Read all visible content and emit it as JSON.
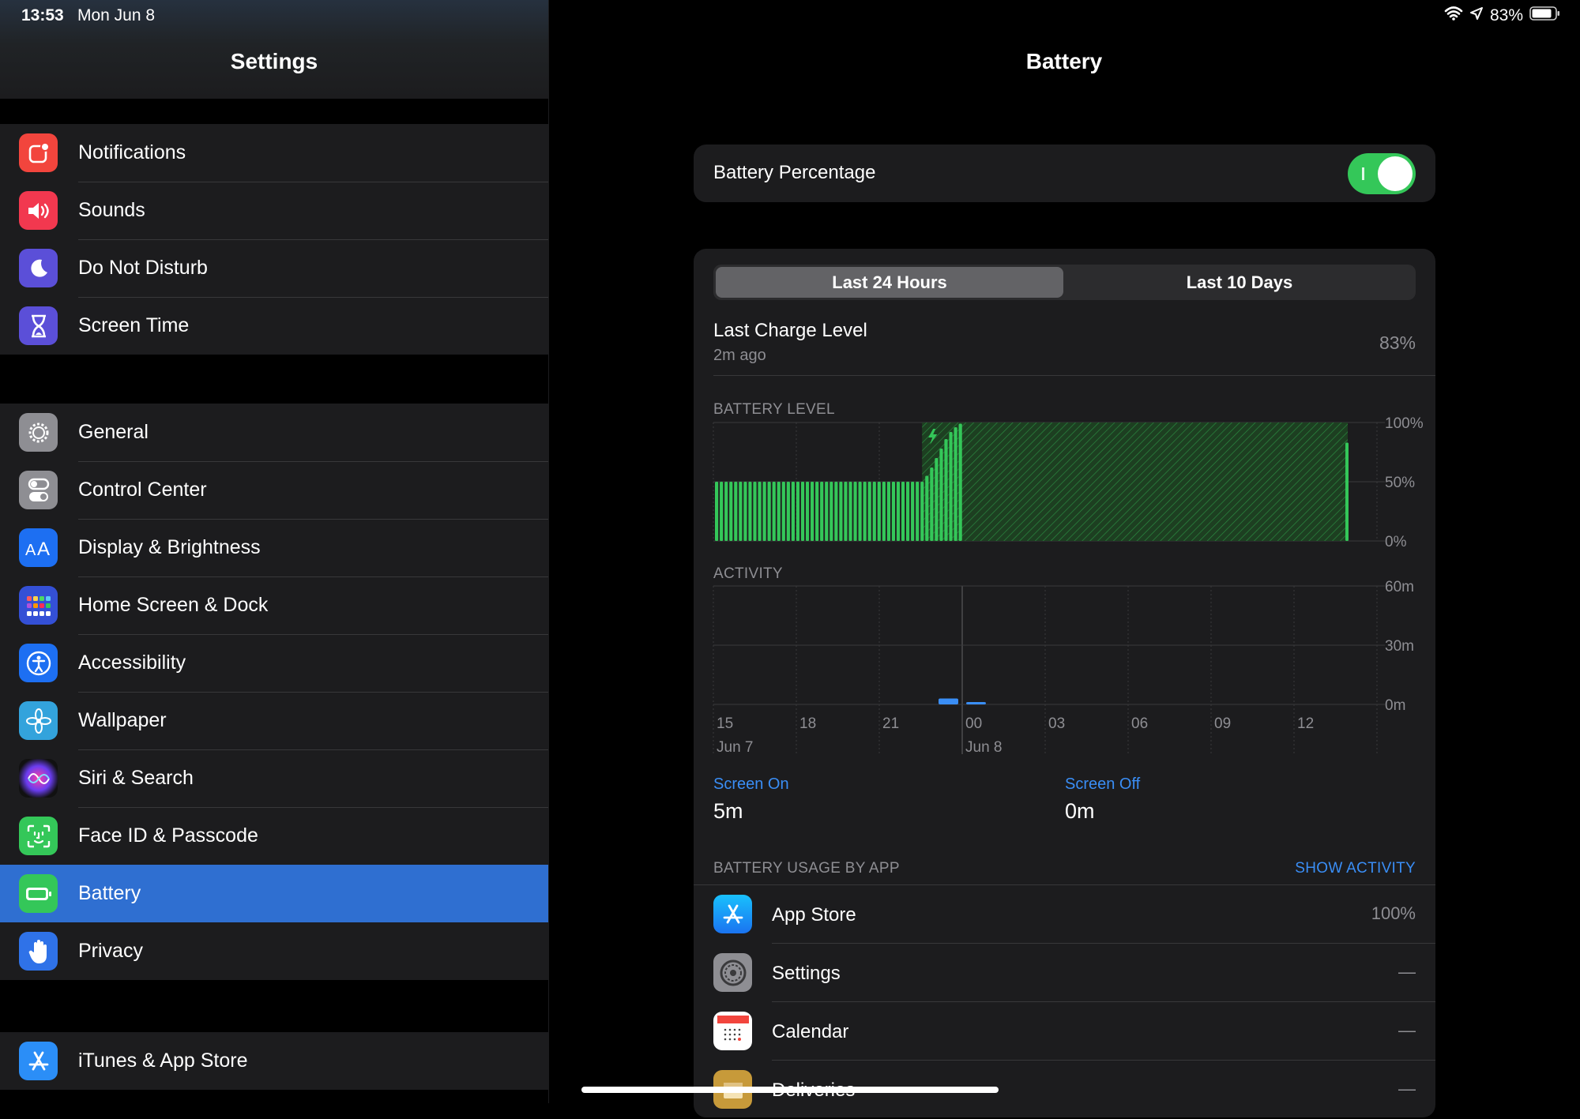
{
  "status": {
    "time": "13:53",
    "date": "Mon Jun 8",
    "battery": "83%"
  },
  "sidebar": {
    "title": "Settings",
    "groups": [
      [
        {
          "label": "Notifications",
          "icon": "notifications-icon",
          "color": "#f2453d"
        },
        {
          "label": "Sounds",
          "icon": "speaker-icon",
          "color": "#f2384f"
        },
        {
          "label": "Do Not Disturb",
          "icon": "moon-icon",
          "color": "#5b4fd8"
        },
        {
          "label": "Screen Time",
          "icon": "hourglass-icon",
          "color": "#5b4fd8"
        }
      ],
      [
        {
          "label": "General",
          "icon": "gear-icon",
          "color": "#8e8e93"
        },
        {
          "label": "Control Center",
          "icon": "toggles-icon",
          "color": "#8e8e93"
        },
        {
          "label": "Display & Brightness",
          "icon": "text-size-icon",
          "color": "#1d6ff2"
        },
        {
          "label": "Home Screen & Dock",
          "icon": "app-grid-icon",
          "color": "#3450d6"
        },
        {
          "label": "Accessibility",
          "icon": "accessibility-icon",
          "color": "#1d6ff2"
        },
        {
          "label": "Wallpaper",
          "icon": "flower-icon",
          "color": "#33a3dc"
        },
        {
          "label": "Siri & Search",
          "icon": "siri-icon",
          "color": "#222"
        },
        {
          "label": "Face ID & Passcode",
          "icon": "face-id-icon",
          "color": "#34c759"
        },
        {
          "label": "Battery",
          "icon": "battery-icon",
          "color": "#34c759",
          "selected": true
        },
        {
          "label": "Privacy",
          "icon": "hand-icon",
          "color": "#2f72e8"
        }
      ],
      [
        {
          "label": "iTunes & App Store",
          "icon": "app-store-icon",
          "color": "#2b8ef7"
        }
      ]
    ]
  },
  "detail": {
    "title": "Battery",
    "battery_percentage": {
      "label": "Battery Percentage",
      "on": true
    },
    "tabs": [
      "Last 24 Hours",
      "Last 10 Days"
    ],
    "last_charge": {
      "title": "Last Charge Level",
      "subtitle": "2m ago",
      "value": "83%"
    },
    "battery_level_label": "BATTERY LEVEL",
    "activity_label": "ACTIVITY",
    "screen_on": {
      "label": "Screen On",
      "value": "5m"
    },
    "screen_off": {
      "label": "Screen Off",
      "value": "0m"
    },
    "usage_label": "BATTERY USAGE BY APP",
    "show_activity": "SHOW ACTIVITY",
    "apps": [
      {
        "name": "App Store",
        "value": "100%",
        "icon": "app-store-icon"
      },
      {
        "name": "Settings",
        "value": "—",
        "icon": "gear-icon"
      },
      {
        "name": "Calendar",
        "value": "—",
        "icon": "calendar-icon"
      },
      {
        "name": "Deliveries",
        "value": "—",
        "icon": "package-icon"
      }
    ]
  },
  "chart_data": [
    {
      "type": "bar",
      "title": "BATTERY LEVEL",
      "y_ticks": [
        "100%",
        "50%",
        "0%"
      ],
      "ylim": [
        0,
        100
      ],
      "x_tick_labels": [
        "15",
        "18",
        "21",
        "00",
        "03",
        "06",
        "09",
        "12"
      ],
      "x_date_labels": [
        "Jun 7",
        "Jun 8"
      ],
      "series": [
        {
          "values": [
            50,
            50,
            50,
            50,
            50,
            50,
            50,
            50,
            50,
            50,
            50,
            50,
            50,
            50,
            50,
            50,
            50,
            50,
            50,
            50,
            50,
            50,
            50,
            50,
            50,
            50,
            50,
            50,
            50,
            50,
            50,
            50,
            50,
            50,
            50,
            50,
            50,
            50,
            50,
            50,
            50,
            50,
            50,
            50,
            55,
            62,
            70,
            78,
            86,
            92,
            96,
            99
          ],
          "charging_from_index": 44,
          "note_fill": "full charge plateau until ~13:00, single bar at 13:53 = 83%"
        }
      ],
      "plateau_value": 100,
      "last_value": 83
    },
    {
      "type": "bar",
      "title": "ACTIVITY",
      "y_ticks": [
        "60m",
        "30m",
        "0m"
      ],
      "ylim": [
        0,
        60
      ],
      "x_tick_labels": [
        "15",
        "18",
        "21",
        "00",
        "03",
        "06",
        "09",
        "12"
      ],
      "x_date_labels": [
        "Jun 7",
        "Jun 8"
      ],
      "series": [
        {
          "name": "Screen On",
          "values": [
            0,
            0,
            0,
            0,
            0,
            0,
            0,
            0,
            3,
            1,
            0,
            0,
            0,
            0,
            0,
            0,
            0,
            0,
            0,
            0,
            0,
            0,
            0,
            0
          ]
        }
      ]
    }
  ]
}
